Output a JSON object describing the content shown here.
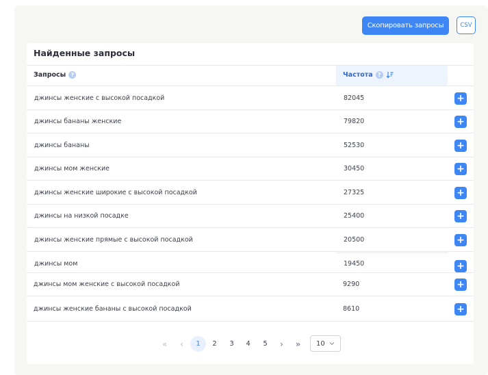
{
  "toolbar": {
    "copy_label": "Скопировать запросы",
    "csv_label": "CSV"
  },
  "card": {
    "title": "Найденные запросы"
  },
  "table": {
    "columns": {
      "query": "Запросы",
      "frequency": "Частота"
    },
    "help_glyph": "?",
    "plus_glyph": "+",
    "rows": [
      {
        "query": "джинсы женские с высокой посадкой",
        "frequency": "82045"
      },
      {
        "query": "джинсы бананы женские",
        "frequency": "79820"
      },
      {
        "query": "джинсы бананы",
        "frequency": "52530"
      },
      {
        "query": "джинсы мом женские",
        "frequency": "30450"
      },
      {
        "query": "джинсы женские широкие с высокой посадкой",
        "frequency": "27325"
      },
      {
        "query": "джинсы на низкой посадке",
        "frequency": "25400"
      },
      {
        "query": "джинсы женские прямые с высокой посадкой",
        "frequency": "20500"
      },
      {
        "query": "джинсы мом",
        "frequency": "19450"
      },
      {
        "query": "джинсы мом женские с высокой посадкой",
        "frequency": "9290"
      },
      {
        "query": "джинсы женские бананы с высокой посадкой",
        "frequency": "8610"
      }
    ]
  },
  "pagination": {
    "first": "«",
    "prev": "‹",
    "pages": [
      "1",
      "2",
      "3",
      "4",
      "5"
    ],
    "current": "1",
    "next": "›",
    "last": "»",
    "per_page": "10"
  },
  "colors": {
    "accent": "#3d86f4",
    "panel_bg": "#f6f6f2"
  },
  "icons": {
    "help": "help-circle-icon",
    "sort": "sort-descending-icon",
    "plus": "plus-icon",
    "chevron": "chevron-down-icon"
  }
}
